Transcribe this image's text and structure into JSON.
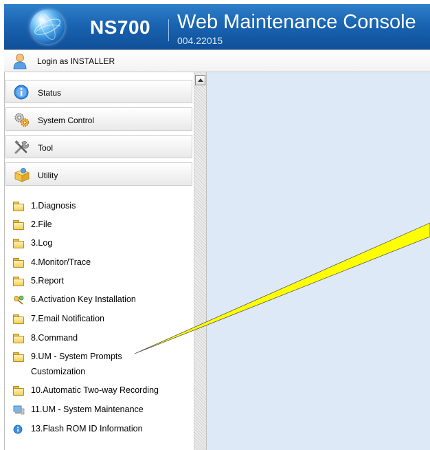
{
  "header": {
    "product": "NS700",
    "title": "Web Maintenance Console",
    "version": "004.22015"
  },
  "login": {
    "text": "Login as INSTALLER"
  },
  "menu": [
    {
      "label": "Status",
      "icon": "info-icon"
    },
    {
      "label": "System Control",
      "icon": "gears-icon"
    },
    {
      "label": "Tool",
      "icon": "tools-icon"
    },
    {
      "label": "Utility",
      "icon": "box-icon"
    }
  ],
  "utility_items": [
    {
      "label": "1.Diagnosis",
      "icon": "folder-icon"
    },
    {
      "label": "2.File",
      "icon": "folder-icon"
    },
    {
      "label": "3.Log",
      "icon": "folder-icon"
    },
    {
      "label": "4.Monitor/Trace",
      "icon": "folder-icon"
    },
    {
      "label": "5.Report",
      "icon": "folder-icon"
    },
    {
      "label": "6.Activation Key Installation",
      "icon": "key-icon"
    },
    {
      "label": "7.Email Notification",
      "icon": "folder-icon"
    },
    {
      "label": "8.Command",
      "icon": "folder-icon"
    },
    {
      "label": "9.UM - System Prompts",
      "label_line2": "Customization",
      "icon": "folder-icon"
    },
    {
      "label": "10.Automatic Two-way Recording",
      "icon": "folder-icon"
    },
    {
      "label": "11.UM - System Maintenance",
      "icon": "computer-icon"
    },
    {
      "label": "13.Flash ROM ID Information",
      "icon": "info-icon"
    }
  ],
  "colors": {
    "header_bg": "#1a64b2",
    "content_bg": "#dde9f6",
    "callout_fill": "#ffff00"
  }
}
